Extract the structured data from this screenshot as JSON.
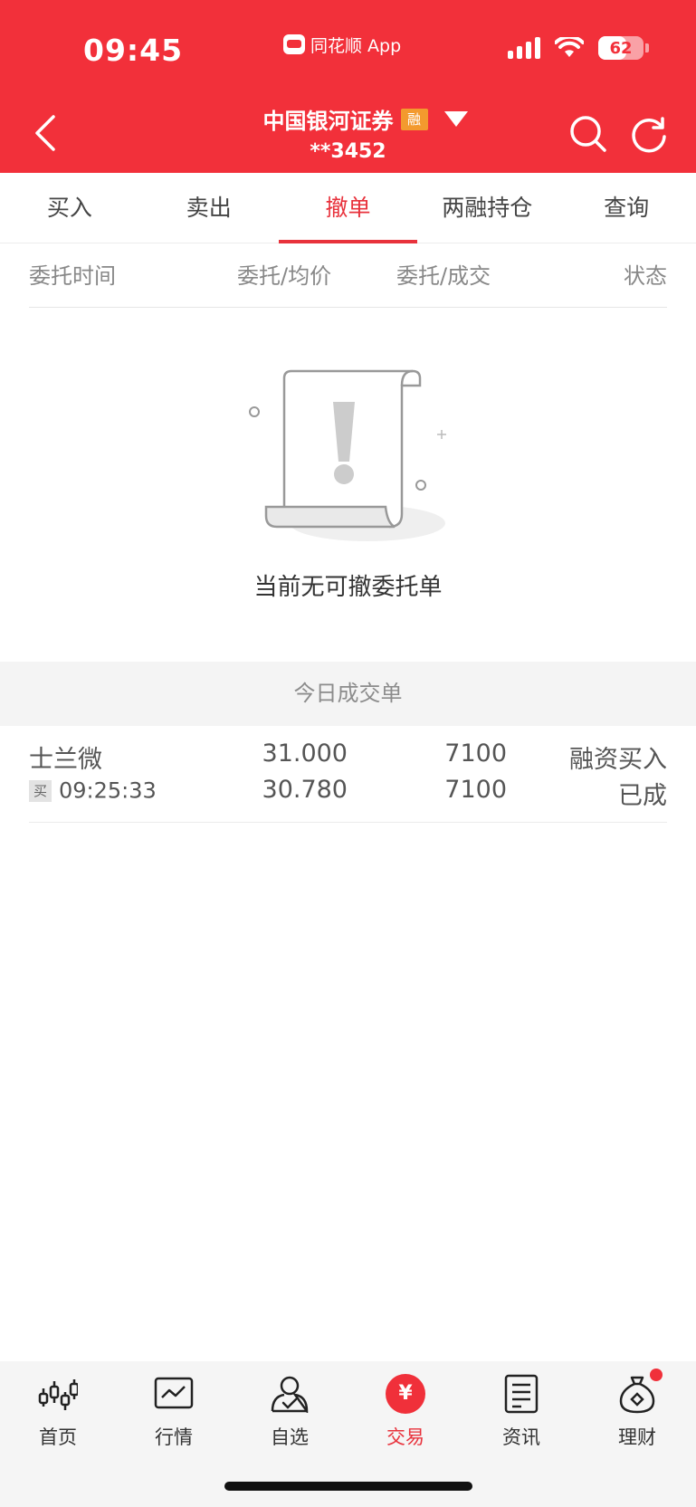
{
  "status_bar": {
    "time": "09:45",
    "app_name": "同花顺 App",
    "battery": "62"
  },
  "header": {
    "title": "中国银河证券",
    "badge": "融",
    "account": "**3452"
  },
  "tabs": [
    {
      "label": "买入"
    },
    {
      "label": "卖出"
    },
    {
      "label": "撤单",
      "active": true
    },
    {
      "label": "两融持仓"
    },
    {
      "label": "查询"
    }
  ],
  "columns": {
    "time": "委托时间",
    "price": "委托/均价",
    "volume": "委托/成交",
    "status": "状态"
  },
  "empty_state": {
    "message": "当前无可撤委托单"
  },
  "today_section": {
    "title": "今日成交单"
  },
  "trades": [
    {
      "name": "士兰微",
      "side_tag": "买",
      "time": "09:25:33",
      "order_price": "31.000",
      "avg_price": "30.780",
      "order_qty": "7100",
      "filled_qty": "7100",
      "type": "融资买入",
      "status": "已成"
    }
  ],
  "bottom_nav": [
    {
      "label": "首页",
      "icon": "candlestick-icon"
    },
    {
      "label": "行情",
      "icon": "market-chart-icon"
    },
    {
      "label": "自选",
      "icon": "user-check-icon"
    },
    {
      "label": "交易",
      "icon": "yen-circle-icon",
      "active": true
    },
    {
      "label": "资讯",
      "icon": "document-icon"
    },
    {
      "label": "理财",
      "icon": "money-bag-icon",
      "badge_dot": true
    }
  ],
  "colors": {
    "brand_red": "#f2303a",
    "active_tab": "#e8323c",
    "badge_orange": "#f39a2e"
  }
}
